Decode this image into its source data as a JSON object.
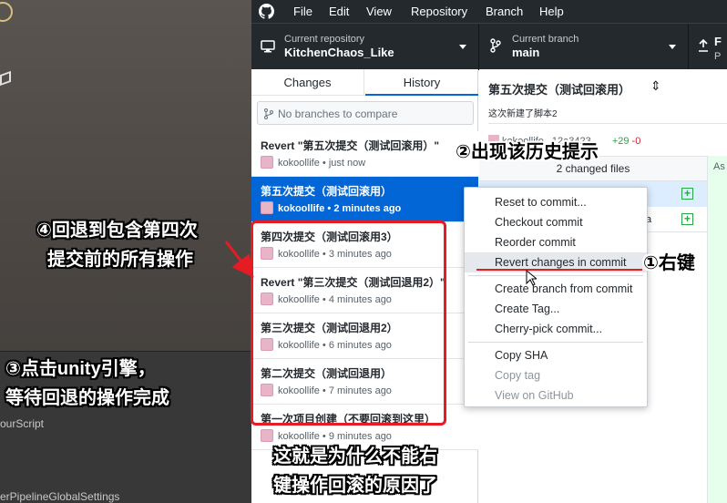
{
  "unity": {
    "assets": [
      "ourScript",
      "erPipelineGlobalSettings"
    ]
  },
  "menubar": {
    "items": [
      "File",
      "Edit",
      "View",
      "Repository",
      "Branch",
      "Help"
    ]
  },
  "toolbar": {
    "repo_label": "Current repository",
    "repo_name": "KitchenChaos_Like",
    "branch_label": "Current branch",
    "branch_name": "main",
    "fetch_big": "F",
    "fetch_small": "P"
  },
  "tabs": {
    "changes": "Changes",
    "history": "History"
  },
  "branch_compare": {
    "placeholder": "No branches to compare"
  },
  "commits": [
    {
      "title": "Revert \"第五次提交（测试回滚用）\"",
      "author": "kokoollife",
      "time": "just now",
      "selected": false
    },
    {
      "title": "第五次提交（测试回滚用）",
      "author": "kokoollife",
      "time": "2 minutes ago",
      "selected": true
    },
    {
      "title": "第四次提交（测试回滚用3）",
      "author": "kokoollife",
      "time": "3 minutes ago",
      "selected": false
    },
    {
      "title": "Revert \"第三次提交（测试回退用2）\"",
      "author": "kokoollife",
      "time": "4 minutes ago",
      "selected": false
    },
    {
      "title": "第三次提交（测试回退用2）",
      "author": "kokoollife",
      "time": "6 minutes ago",
      "selected": false
    },
    {
      "title": "第二次提交（测试回退用）",
      "author": "kokoollife",
      "time": "7 minutes ago",
      "selected": false
    },
    {
      "title": "第一次项目创建（不要回滚到这里）",
      "author": "kokoollife",
      "time": "9 minutes ago",
      "selected": false
    }
  ],
  "detail": {
    "title": "第五次提交（测试回滚用）",
    "description": "这次新建了脚本2",
    "meta_author": "kokoollife",
    "meta_hash": "12a3423",
    "additions": "+29",
    "deletions": "-0",
    "changed_files": "2 changed files",
    "file2_name": "ta",
    "diff_header": "As"
  },
  "context_menu": {
    "items": [
      {
        "label": "Reset to commit...",
        "disabled": false,
        "hover": false
      },
      {
        "label": "Checkout commit",
        "disabled": false,
        "hover": false
      },
      {
        "label": "Reorder commit",
        "disabled": false,
        "hover": false
      },
      {
        "label": "Revert changes in commit",
        "disabled": false,
        "hover": true
      },
      {
        "label": "Create branch from commit",
        "disabled": false,
        "hover": false
      },
      {
        "label": "Create Tag...",
        "disabled": false,
        "hover": false
      },
      {
        "label": "Cherry-pick commit...",
        "disabled": false,
        "hover": false
      },
      {
        "label": "Copy SHA",
        "disabled": false,
        "hover": false
      },
      {
        "label": "Copy tag",
        "disabled": true,
        "hover": false
      },
      {
        "label": "View on GitHub",
        "disabled": true,
        "hover": false
      }
    ]
  },
  "annotations": {
    "step1": "①右键",
    "step2": "②出现该历史提示",
    "step3_line1": "③点击unity引擎，",
    "step3_line2": "等待回退的操作完成",
    "step4_line1": "④回退到包含第四次",
    "step4_line2": "提交前的所有操作",
    "note_line1": "这就是为什么不能右",
    "note_line2": "键操作回滚的原因了"
  },
  "colors": {
    "annotation_red": "#e51c23",
    "selected_blue": "#0366d6",
    "toolbar_dark": "#24292e"
  }
}
